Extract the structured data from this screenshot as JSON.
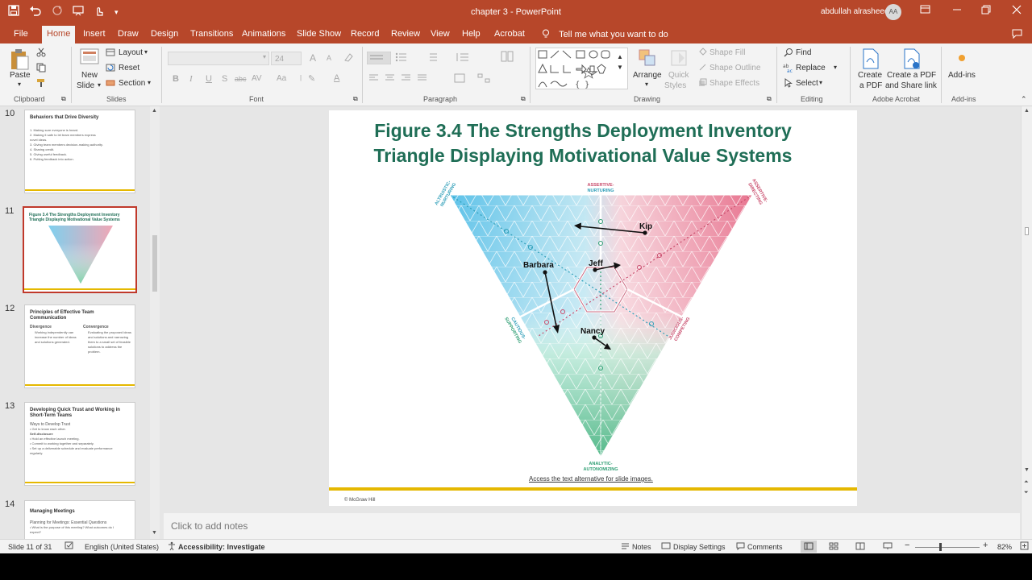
{
  "titlebar": {
    "doc_title": "chapter 3  -  PowerPoint",
    "user_name": "abdullah alrasheed",
    "user_initials": "AA",
    "qat_icons": [
      "save-icon",
      "undo-icon",
      "redo-icon",
      "start-slideshow-icon",
      "touch-mode-icon",
      "customize-icon"
    ],
    "window_icons": [
      "ribbon-display-icon",
      "minimize-icon",
      "restore-icon",
      "close-icon"
    ]
  },
  "tabs": [
    "File",
    "Home",
    "Insert",
    "Draw",
    "Design",
    "Transitions",
    "Animations",
    "Slide Show",
    "Record",
    "Review",
    "View",
    "Help",
    "Acrobat"
  ],
  "active_tab": "Home",
  "tell_me": "Tell me what you want to do",
  "ribbon": {
    "clipboard": {
      "paste": "Paste",
      "label": "Clipboard"
    },
    "slides": {
      "new_slide_1": "New",
      "new_slide_2": "Slide",
      "layout": "Layout",
      "reset": "Reset",
      "section": "Section",
      "label": "Slides"
    },
    "font": {
      "size": "24",
      "bold": "B",
      "italic": "I",
      "underline": "U",
      "strike": "S",
      "shadow": "abc",
      "spacing": "AV",
      "case": "Aa",
      "color": "A",
      "grow": "A",
      "shrink": "A",
      "label": "Font"
    },
    "paragraph": {
      "label": "Paragraph"
    },
    "drawing": {
      "arrange": "Arrange",
      "quick_styles_1": "Quick",
      "quick_styles_2": "Styles",
      "shape_fill": "Shape Fill",
      "shape_outline": "Shape Outline",
      "shape_effects": "Shape Effects",
      "label": "Drawing"
    },
    "editing": {
      "find": "Find",
      "replace": "Replace",
      "select": "Select",
      "label": "Editing"
    },
    "acrobat": {
      "create_pdf_1": "Create",
      "create_pdf_2": "a PDF",
      "share_1": "Create a PDF",
      "share_2": "and Share link",
      "label": "Adobe Acrobat"
    },
    "addins": {
      "addins": "Add-ins",
      "label": "Add-ins"
    }
  },
  "thumbnails": [
    {
      "number": "10",
      "title": "Behaviors that Drive Diversity",
      "lines": [
        "1.  Making sure everyone is heard.",
        "2.  Making it safe to let team members express",
        "     novel ideas.",
        "3.  Giving team members decision-making authority.",
        "4.  Sharing credit.",
        "5.  Giving useful feedback.",
        "6.  Putting feedback into action."
      ]
    },
    {
      "number": "11",
      "title": "Figure 3.4 The Strengths Deployment Inventory Triangle Displaying Motivational Value Systems",
      "lines": []
    },
    {
      "number": "12",
      "title": "Principles of Effective Team Communication",
      "col1_head": "Divergence",
      "col1": "Working independently can increase the number of ideas and solutions generated.",
      "col2_head": "Convergence",
      "col2": "Evaluating the proposed ideas and solutions and narrowing them to a small set of feasible solutions to address the problem.",
      "lines": []
    },
    {
      "number": "13",
      "title": "Developing Quick Trust and Working in Short-Term Teams",
      "lines": [
        "Ways to Develop Trust",
        "•  Get to know each other.",
        "      Self-disclosure",
        "•  Hold an effective launch meeting.",
        "•  Commit to working together and separately.",
        "•  Set up a deliverable schedule and evaluate performance",
        "    regularly."
      ]
    },
    {
      "number": "14",
      "title": "Managing Meetings",
      "lines": [
        "Planning for Meetings: Essential Questions",
        "•  What is the purpose of this meeting? What outcomes do I",
        "    expect?"
      ]
    }
  ],
  "slide": {
    "title_line1": "Figure 3.4 The Strengths Deployment Inventory",
    "title_line2": "Triangle Displaying Motivational Value Systems",
    "access_link": "Access the text alternative for slide images.",
    "copyright": "© McGraw Hill",
    "labels": {
      "top_center_1": "ASSERTIVE-",
      "top_center_2": "NURTURING",
      "top_left_1": "ALTRUISTIC-",
      "top_left_2": "NURTURING",
      "top_right_1": "ASSERTIVE-",
      "top_right_2": "DIRECTING",
      "left_1": "CAUTIOUS-",
      "left_2": "SUPPORTING",
      "right_1": "JUDICIOUS-",
      "right_2": "COMPETING",
      "bottom_1": "ANALYTIC-",
      "bottom_2": "AUTONOMIZING"
    },
    "people": [
      "Kip",
      "Jeff",
      "Barbara",
      "Nancy"
    ]
  },
  "notes_placeholder": "Click to add notes",
  "status": {
    "slide_counter": "Slide 11 of 31",
    "language": "English (United States)",
    "accessibility": "Accessibility: Investigate",
    "notes": "Notes",
    "display_settings": "Display Settings",
    "comments": "Comments",
    "zoom": "82%"
  },
  "colors": {
    "accent": "#b7472a",
    "slide_title": "#1f6e56",
    "blue": "#3fb6e0",
    "pink": "#e0607a",
    "green": "#47b07c",
    "gold": "#e5b800"
  }
}
